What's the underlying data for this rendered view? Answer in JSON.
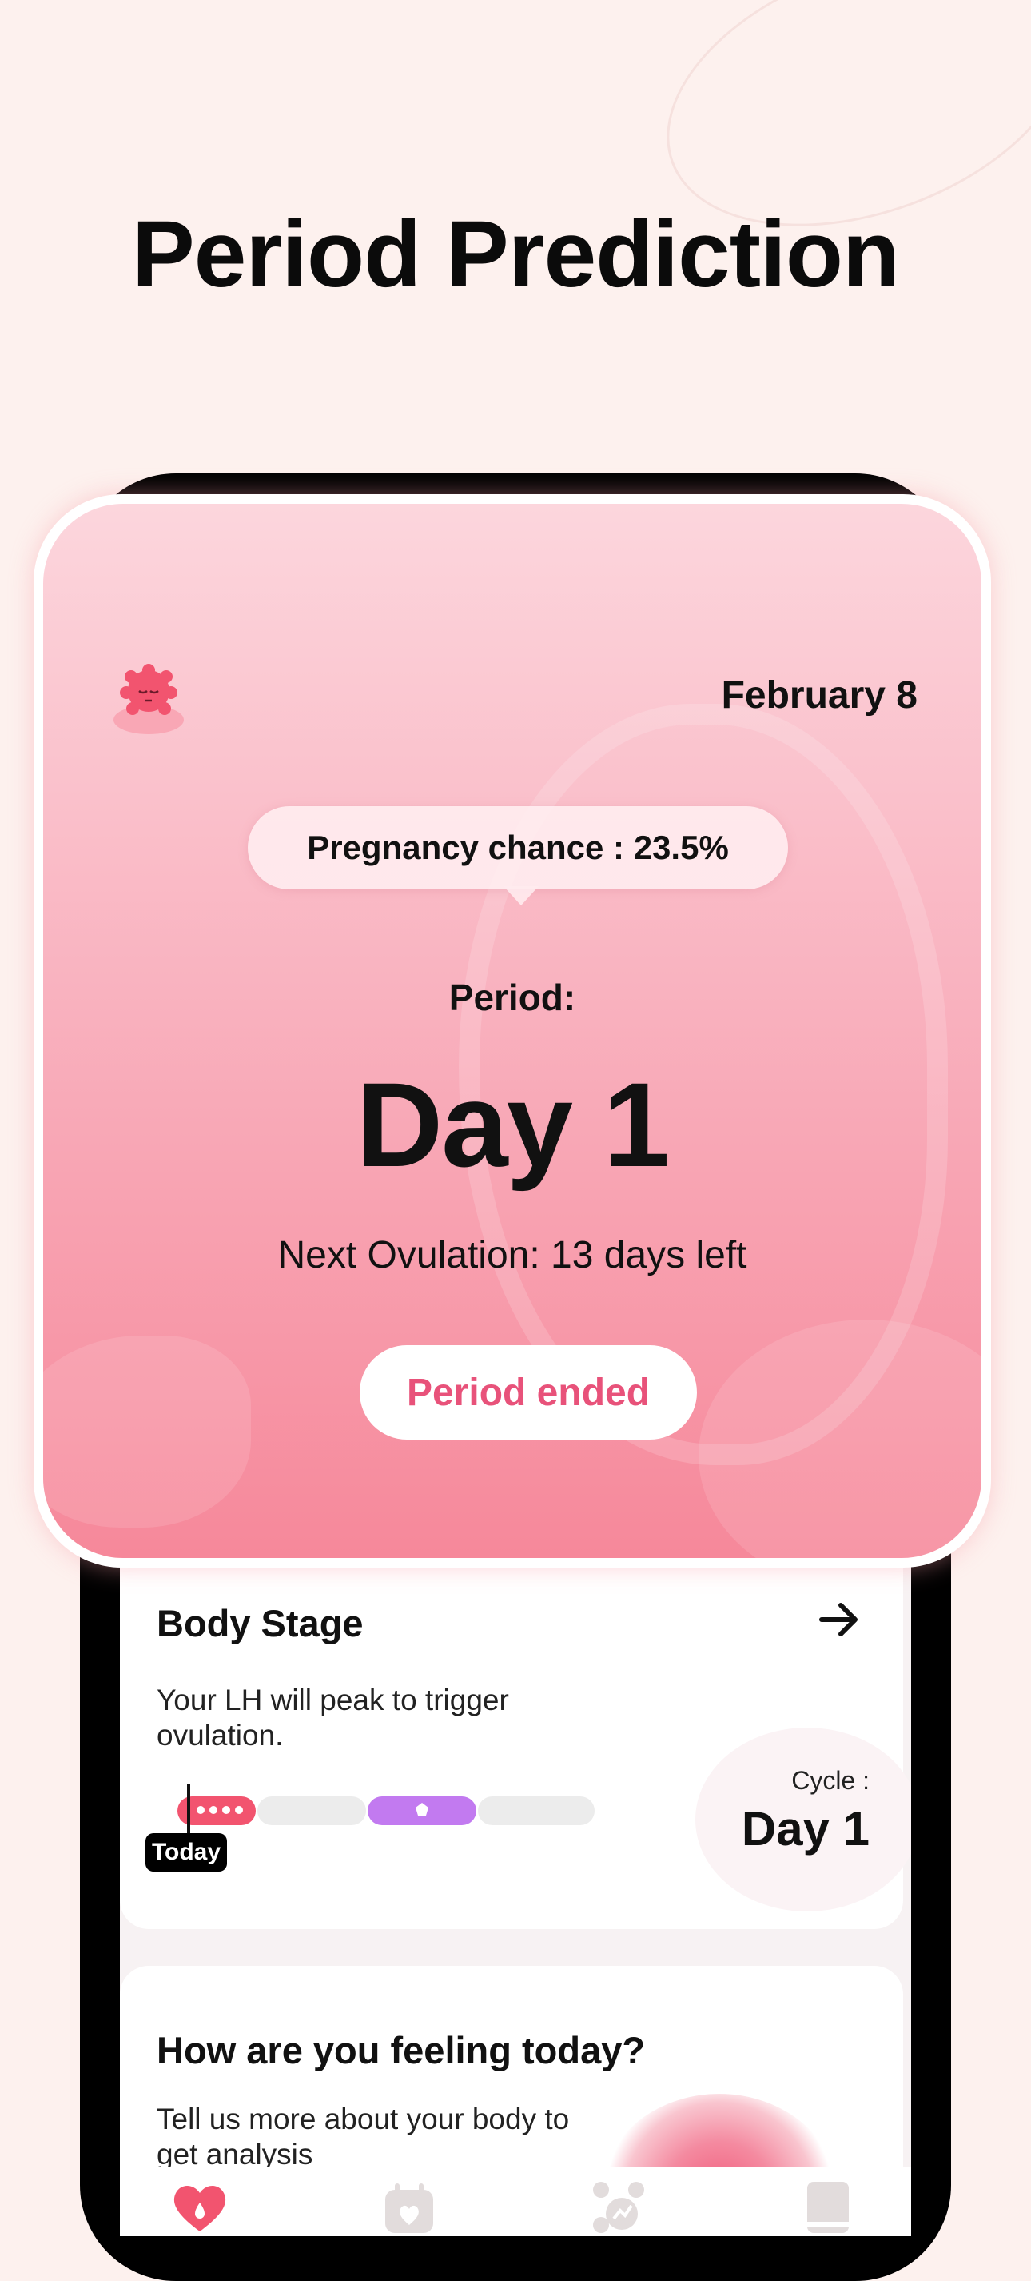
{
  "headline": "Period Prediction",
  "hero": {
    "date": "February 8",
    "pregnancy_chance": "Pregnancy chance : 23.5%",
    "period_label": "Period:",
    "period_day": "Day 1",
    "next_ovulation": "Next Ovulation: 13 days left",
    "period_ended_button": "Period ended"
  },
  "body_stage": {
    "title": "Body Stage",
    "description": "Your LH will peak to trigger ovulation.",
    "cycle_label": "Cycle :",
    "cycle_day": "Day 1",
    "today_tag": "Today"
  },
  "feeling": {
    "title": "How are you feeling today?",
    "description": "Tell us more about your body to get analysis"
  },
  "tabbar": {
    "items": [
      "home-heart-icon",
      "calendar-icon",
      "analysis-icon",
      "book-icon"
    ]
  },
  "colors": {
    "accent": "#e8527a",
    "period_segment": "#f2546f",
    "ovulation_segment": "#c27af0"
  }
}
